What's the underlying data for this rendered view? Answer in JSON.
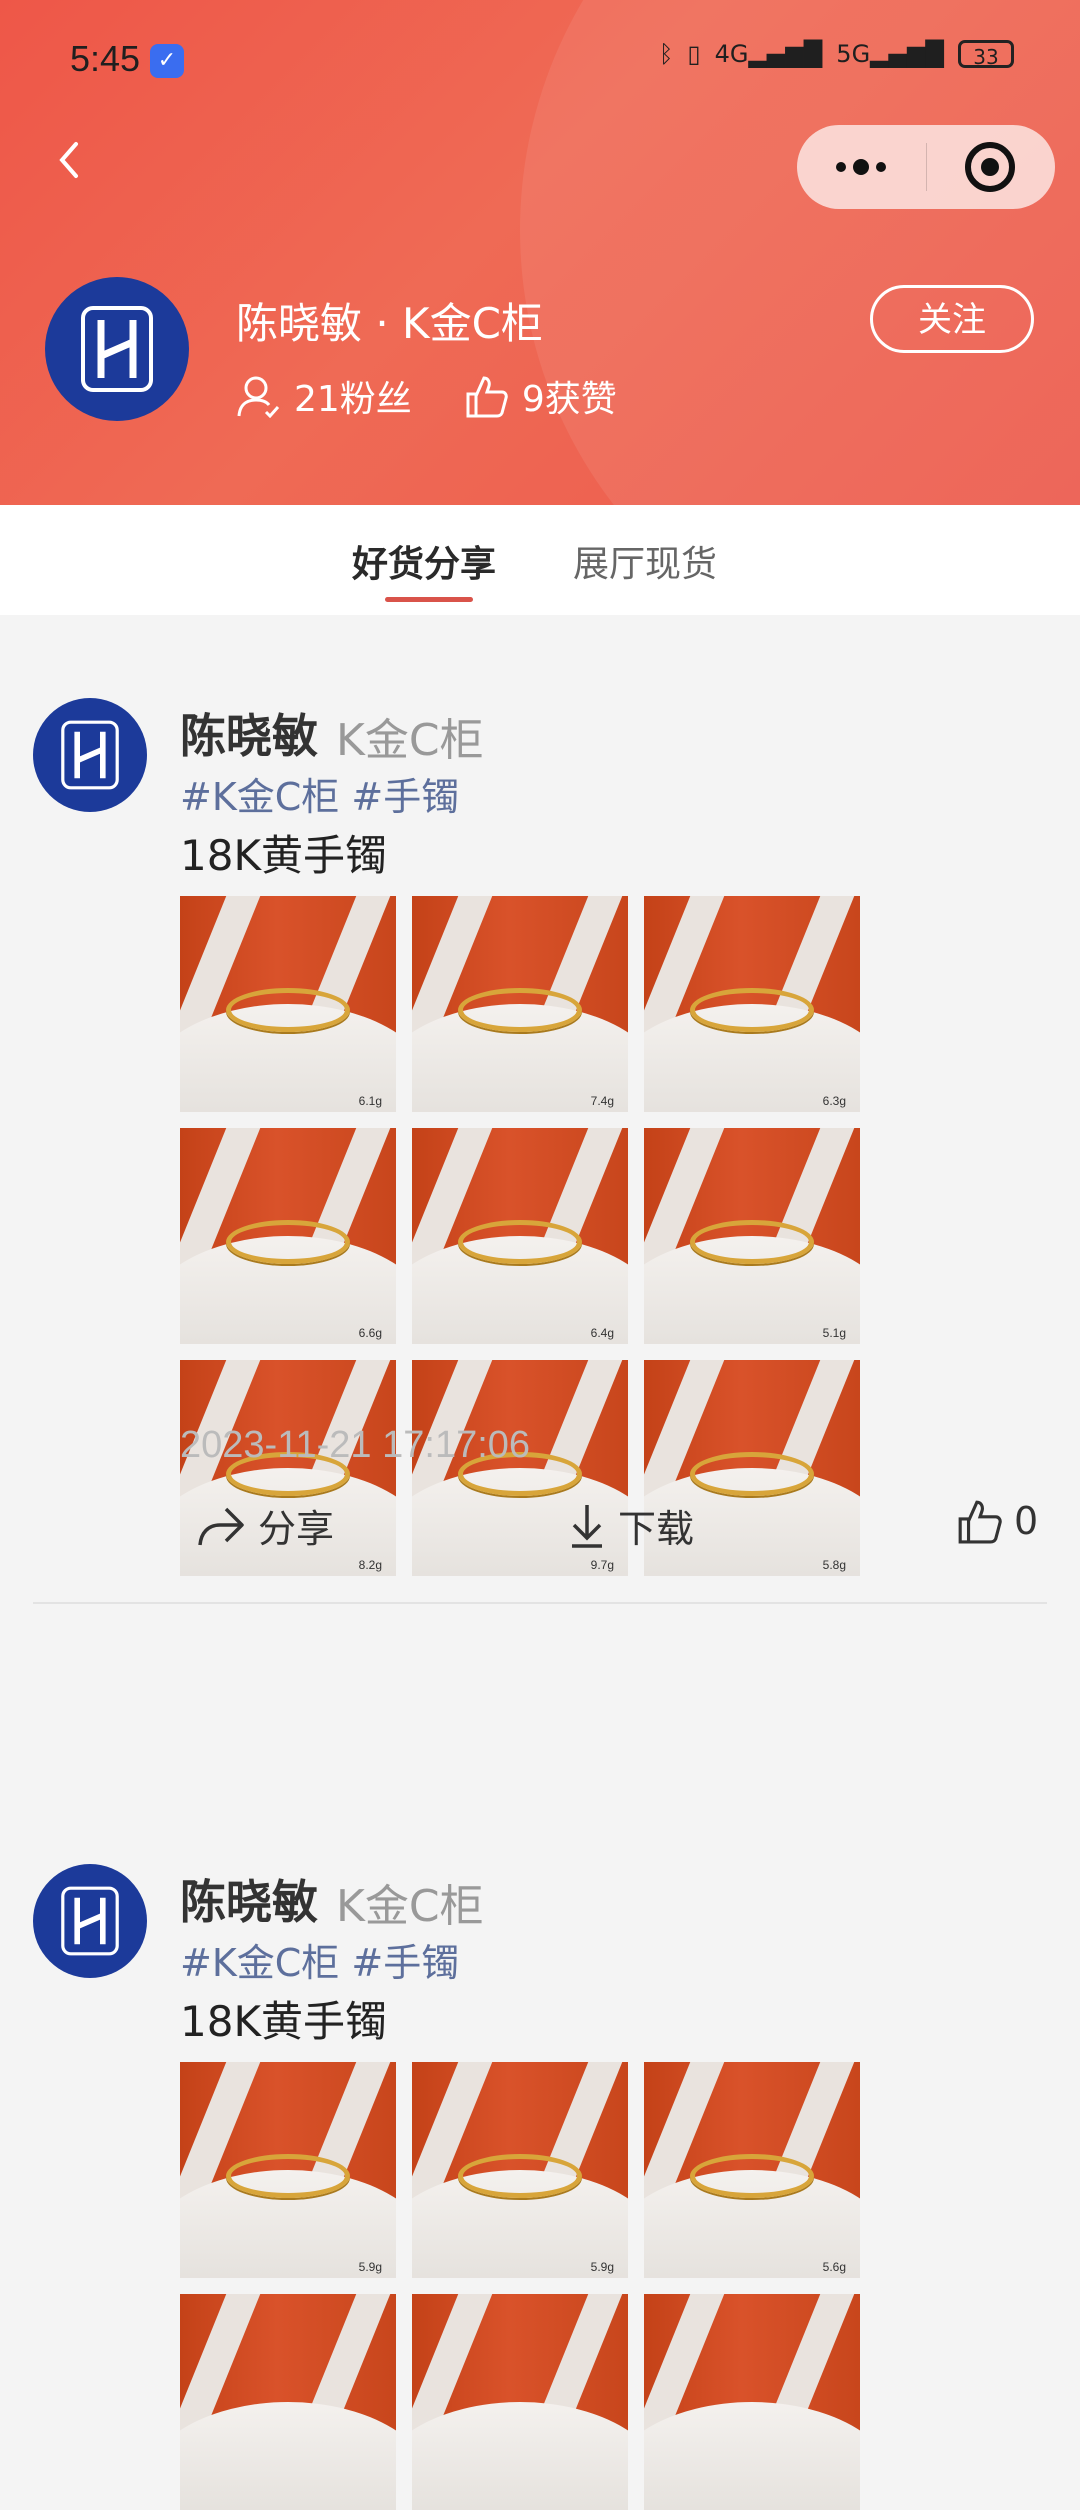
{
  "status_bar": {
    "time": "5:45",
    "battery": "33"
  },
  "header": {
    "shop_name": "陈晓敏 · K金C柜",
    "fans": "21粉丝",
    "likes": "9获赞",
    "follow_label": "关注"
  },
  "tabs": [
    {
      "label": "好货分享",
      "active": true
    },
    {
      "label": "展厅现货",
      "active": false
    }
  ],
  "posts": [
    {
      "author": "陈晓敏",
      "counter": "K金C柜",
      "tags": "#K金C柜 #手镯",
      "title": "18K黄手镯",
      "images": [
        {
          "weight": "6.1g"
        },
        {
          "weight": "7.4g"
        },
        {
          "weight": "6.3g"
        },
        {
          "weight": "6.6g"
        },
        {
          "weight": "6.4g"
        },
        {
          "weight": "5.1g"
        },
        {
          "weight": "8.2g"
        },
        {
          "weight": "9.7g"
        },
        {
          "weight": "5.8g"
        }
      ],
      "date": "2023-11-21 17:17:06",
      "share_label": "分享",
      "download_label": "下载",
      "like_count": "0"
    },
    {
      "author": "陈晓敏",
      "counter": "K金C柜",
      "tags": "#K金C柜 #手镯",
      "title": "18K黄手镯",
      "images": [
        {
          "weight": "5.9g"
        },
        {
          "weight": "5.9g"
        },
        {
          "weight": "5.6g"
        }
      ]
    }
  ],
  "colors": {
    "accent": "#ee5748",
    "tag": "#5d6f9c",
    "avatar": "#1c3a9a"
  }
}
